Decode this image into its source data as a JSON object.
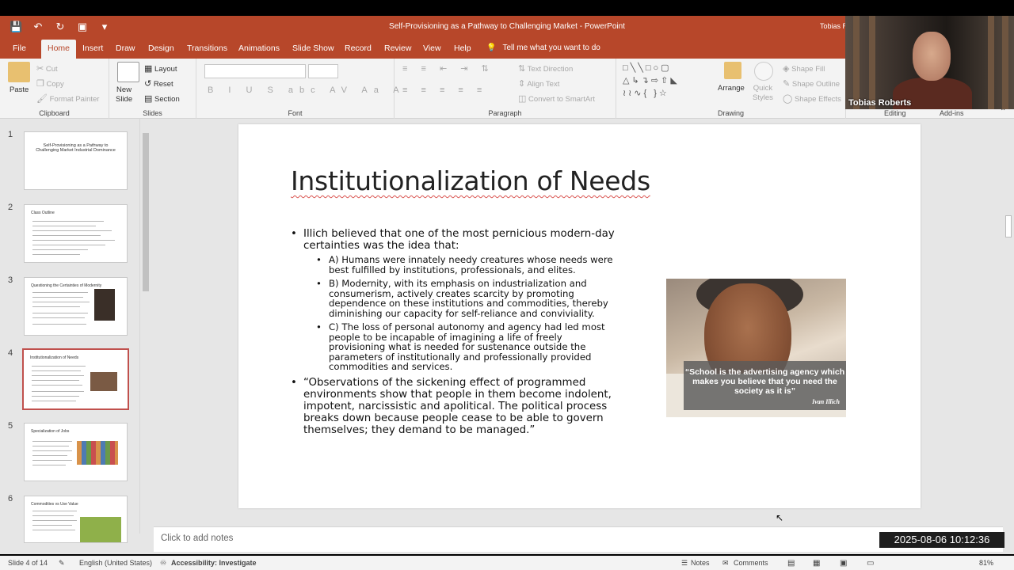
{
  "window": {
    "title": "Self-Provisioning as a Pathway to Challenging Market  -  PowerPoint",
    "user_short": "Tobias R"
  },
  "tabs": [
    "File",
    "Home",
    "Insert",
    "Draw",
    "Design",
    "Transitions",
    "Animations",
    "Slide Show",
    "Record",
    "Review",
    "View",
    "Help"
  ],
  "active_tab": "Home",
  "tell_me": "Tell me what you want to do",
  "ribbon": {
    "clipboard": {
      "label": "Clipboard",
      "paste": "Paste",
      "cut": "Cut",
      "copy": "Copy",
      "format_painter": "Format Painter"
    },
    "slides": {
      "label": "Slides",
      "new_slide_1": "New",
      "new_slide_2": "Slide",
      "layout": "Layout",
      "reset": "Reset",
      "section": "Section"
    },
    "font": {
      "label": "Font"
    },
    "paragraph": {
      "label": "Paragraph",
      "text_direction": "Text Direction",
      "align_text": "Align Text",
      "convert": "Convert to SmartArt"
    },
    "drawing": {
      "label": "Drawing",
      "arrange": "Arrange",
      "quick_styles_1": "Quick",
      "quick_styles_2": "Styles",
      "shape_fill": "Shape Fill",
      "shape_outline": "Shape Outline",
      "shape_effects": "Shape Effects"
    },
    "editing": {
      "label": "Editing"
    },
    "addins": {
      "label": "Add-ins"
    }
  },
  "thumbnails": [
    {
      "num": "1",
      "title": "Self-Provisioning as a Pathway to Challenging Market Industrial Dominance"
    },
    {
      "num": "2",
      "title": "Class Outline"
    },
    {
      "num": "3",
      "title": "Questioning the Certainties of Modernity"
    },
    {
      "num": "4",
      "title": "Institutionalization of Needs"
    },
    {
      "num": "5",
      "title": "Specialization of Jobs"
    },
    {
      "num": "6",
      "title": "Commodities vs Use Value"
    }
  ],
  "slide": {
    "title": "Institutionalization of Needs",
    "bullet1": "Illich believed that one of the most pernicious modern-day certainties was the idea that:",
    "sub1": "A) Humans were innately needy creatures whose needs were best fulfilled by institutions, professionals, and elites.",
    "sub2": "B) Modernity, with its emphasis on industrialization and consumerism, actively creates scarcity by promoting dependence on these institutions and commodities, thereby diminishing our capacity for self-reliance and conviviality.",
    "sub3": "C) The loss of personal autonomy and agency had led most people to be incapable of imagining a life of freely provisioning what is needed for sustenance outside the parameters of institutionally and professionally provided commodities and services.",
    "bullet2": "“Observations of the sickening effect of programmed environments show that people in them become indolent, impotent, narcissistic and apolitical. The political process breaks down because people cease to be able to govern themselves; they demand to be managed.”",
    "image_quote": "“School is the advertising agency which makes you believe that you need the society as it is”",
    "image_author": "Ivan Illich"
  },
  "notes_placeholder": "Click to add notes",
  "status": {
    "slide_count": "Slide 4 of 14",
    "language": "English (United States)",
    "accessibility": "Accessibility: Investigate",
    "notes": "Notes",
    "comments": "Comments",
    "zoom": "81%"
  },
  "webcam_name": "Tobias Roberts",
  "clock": "2025-08-06  10:12:36"
}
